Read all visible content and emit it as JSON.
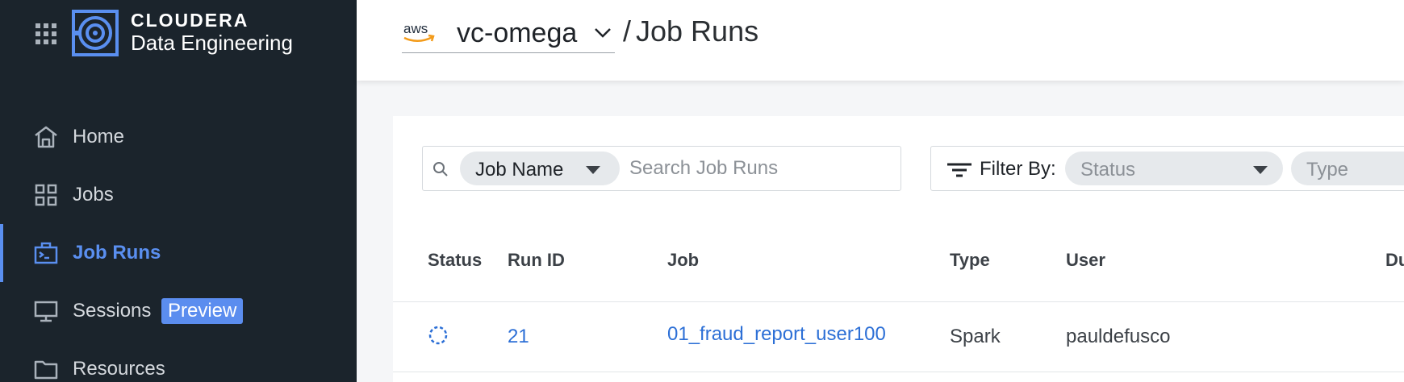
{
  "brand": {
    "line1": "CLOUDERA",
    "line2": "Data Engineering"
  },
  "sidebar": {
    "items": [
      {
        "label": "Home",
        "icon": "home-icon"
      },
      {
        "label": "Jobs",
        "icon": "jobs-icon"
      },
      {
        "label": "Job Runs",
        "icon": "job-runs-icon",
        "active": true
      },
      {
        "label": "Sessions",
        "icon": "monitor-icon",
        "badge": "Preview"
      },
      {
        "label": "Resources",
        "icon": "folder-icon"
      }
    ]
  },
  "header": {
    "env_provider": "aws",
    "env_name": "vc-omega",
    "separator": "/",
    "title": "Job Runs"
  },
  "search": {
    "field": "Job Name",
    "placeholder": "Search Job Runs"
  },
  "filter": {
    "label": "Filter By:",
    "status_placeholder": "Status",
    "type_placeholder": "Type"
  },
  "table": {
    "columns": [
      "Status",
      "Run ID",
      "Job",
      "Type",
      "User",
      "Du"
    ],
    "rows": [
      {
        "status": "running",
        "run_id": "21",
        "job": "01_fraud_report_user100",
        "type": "Spark",
        "user": "pauldefusco"
      }
    ]
  },
  "colors": {
    "sidebar_bg": "#1b242c",
    "accent": "#5a8ff0",
    "link": "#2c6fd6"
  }
}
